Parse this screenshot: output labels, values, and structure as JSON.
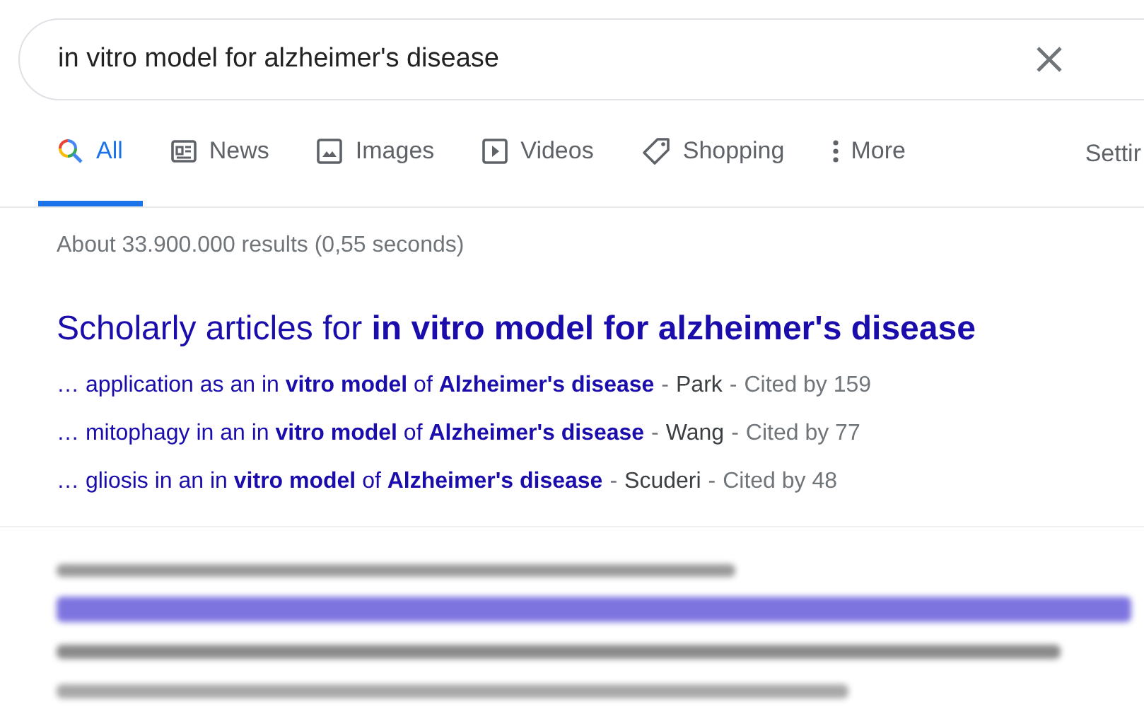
{
  "search": {
    "value": "in vitro model for alzheimer's disease"
  },
  "tabs": [
    {
      "label": "All",
      "selected": true
    },
    {
      "label": "News",
      "selected": false
    },
    {
      "label": "Images",
      "selected": false
    },
    {
      "label": "Videos",
      "selected": false
    },
    {
      "label": "Shopping",
      "selected": false
    },
    {
      "label": "More",
      "selected": false
    }
  ],
  "settings": "Settir",
  "result_stats": "About 33.900.000 results (0,55 seconds)",
  "scholarly": {
    "title": "Scholarly articles for **in vitro model for alzheimer's disease**",
    "articles": [
      {
        "link": "… application as an in **vitro model** of **Alzheimer's disease**",
        "dash_1": "-",
        "author": "Park",
        "dash_2": "-",
        "cited": "Cited by 159"
      },
      {
        "link": "… mitophagy in an in **vitro model** of **Alzheimer's disease**",
        "dash_1": "-",
        "author": "Wang",
        "dash_2": "-",
        "cited": "Cited by 77"
      },
      {
        "link": "… gliosis in an in **vitro model** of **Alzheimer's disease**",
        "dash_1": "-",
        "author": "Scuderi",
        "dash_2": "-",
        "cited": "Cited by 48"
      }
    ]
  }
}
